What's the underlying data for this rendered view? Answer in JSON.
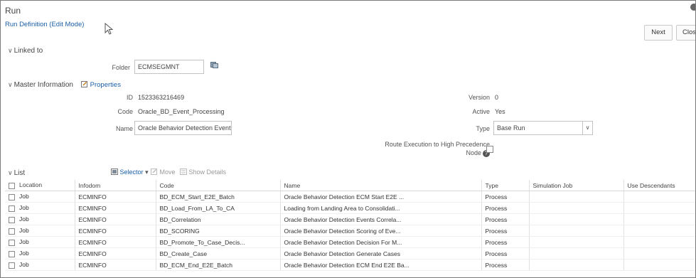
{
  "header": {
    "title": "Run",
    "subtitle": "Run Definition (Edit Mode)"
  },
  "buttons": {
    "next": "Next",
    "close": "Close"
  },
  "linked_to": {
    "section_label": "Linked to",
    "folder_label": "Folder",
    "folder_value": "ECMSEGMNT"
  },
  "master": {
    "section_label": "Master Information",
    "properties_label": "Properties",
    "id_label": "ID",
    "id_value": "1523363216469",
    "code_label": "Code",
    "code_value": "Oracle_BD_Event_Processing",
    "name_label": "Name",
    "name_value": "Oracle Behavior Detection Event Proce",
    "version_label": "Version",
    "version_value": "0",
    "active_label": "Active",
    "active_value": "Yes",
    "type_label": "Type",
    "type_value": "Base Run",
    "route_label_1": "Route Execution to High Precedence",
    "route_label_2": "Node"
  },
  "list": {
    "section_label": "List",
    "toolbar": {
      "selector": "Selector",
      "move": "Move",
      "show_details": "Show Details"
    },
    "columns": [
      "Location",
      "Infodom",
      "Code",
      "Name",
      "Type",
      "Simulation Job",
      "Use Descendants"
    ],
    "rows": [
      {
        "location": "Job",
        "infodom": "ECMINFO",
        "code": "BD_ECM_Start_E2E_Batch",
        "name": "Oracle Behavior Detection ECM Start E2E ...",
        "type": "Process",
        "sim": "",
        "desc": ""
      },
      {
        "location": "Job",
        "infodom": "ECMINFO",
        "code": "BD_Load_From_LA_To_CA",
        "name": "Loading from Landing Area to Consolidati...",
        "type": "Process",
        "sim": "",
        "desc": ""
      },
      {
        "location": "Job",
        "infodom": "ECMINFO",
        "code": "BD_Correlation",
        "name": "Oracle Behavior Detection Events Correla...",
        "type": "Process",
        "sim": "",
        "desc": ""
      },
      {
        "location": "Job",
        "infodom": "ECMINFO",
        "code": "BD_SCORING",
        "name": "Oracle Behavior Detection Scoring of Eve...",
        "type": "Process",
        "sim": "",
        "desc": ""
      },
      {
        "location": "Job",
        "infodom": "ECMINFO",
        "code": "BD_Promote_To_Case_Decis...",
        "name": "Oracle Behavior Detection Decision For M...",
        "type": "Process",
        "sim": "",
        "desc": ""
      },
      {
        "location": "Job",
        "infodom": "ECMINFO",
        "code": "BD_Create_Case",
        "name": "Oracle Behavior Detection Generate Cases",
        "type": "Process",
        "sim": "",
        "desc": ""
      },
      {
        "location": "Job",
        "infodom": "ECMINFO",
        "code": "BD_ECM_End_E2E_Batch",
        "name": "Oracle Behavior Detection ECM End E2E Ba...",
        "type": "Process",
        "sim": "",
        "desc": ""
      }
    ]
  }
}
